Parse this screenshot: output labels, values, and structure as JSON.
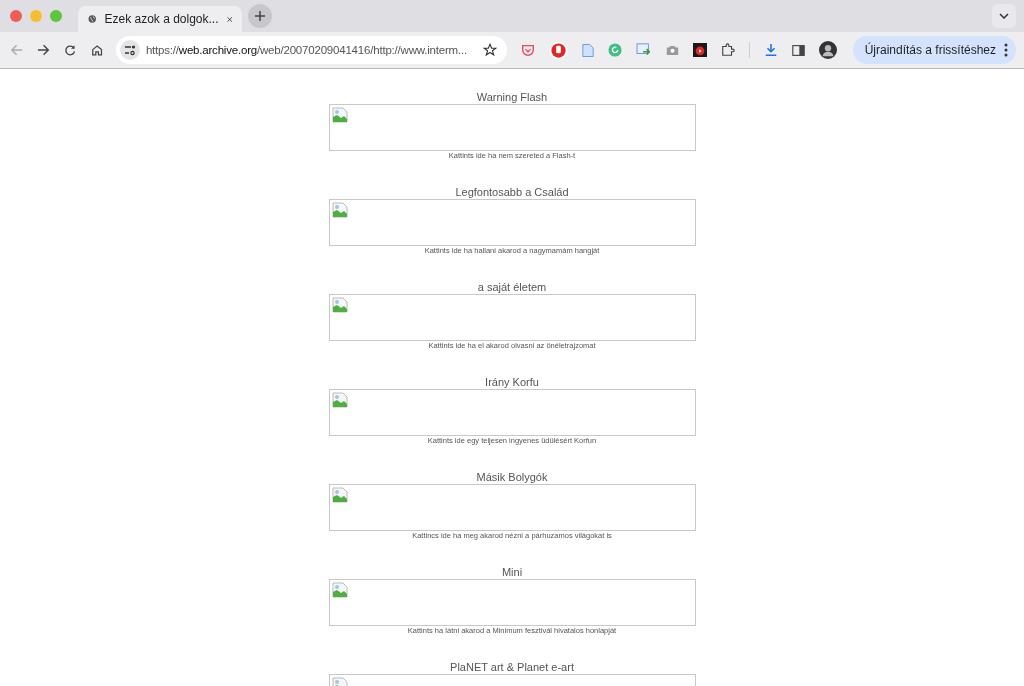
{
  "window": {
    "tab": {
      "title": "Ezek azok a dolgok...",
      "selected": true
    },
    "address": {
      "host_prefix": "https://",
      "host": "web.archive.org",
      "path": "/web/20070209041416/http://www.interm..."
    },
    "update_button": "Újraindítás a frissítéshez"
  },
  "entries": [
    {
      "title": "Warning Flash",
      "caption": "Kattints ide ha nem szereted a Flash-t"
    },
    {
      "title": "Legfontosabb a Család",
      "caption": "Kattints ide ha hallani akarod a nagymamám hangját"
    },
    {
      "title": "a saját életem",
      "caption": "Kattints ide ha el akarod olvasni az önéletrajzomat"
    },
    {
      "title": "Irány Korfu",
      "caption": "Kattints ide egy teljesen ingyenes üdülésért Korfun"
    },
    {
      "title": "Másik Bolygók",
      "caption": "Kattincs ide ha meg akarod nézni a párhuzamos világokat is"
    },
    {
      "title": "Mini",
      "caption": "Kattints ha látni akarod a Minimum fesztivál hivatalos honlapját"
    },
    {
      "title": "PlaNET art & Planet e-art"
    }
  ]
}
